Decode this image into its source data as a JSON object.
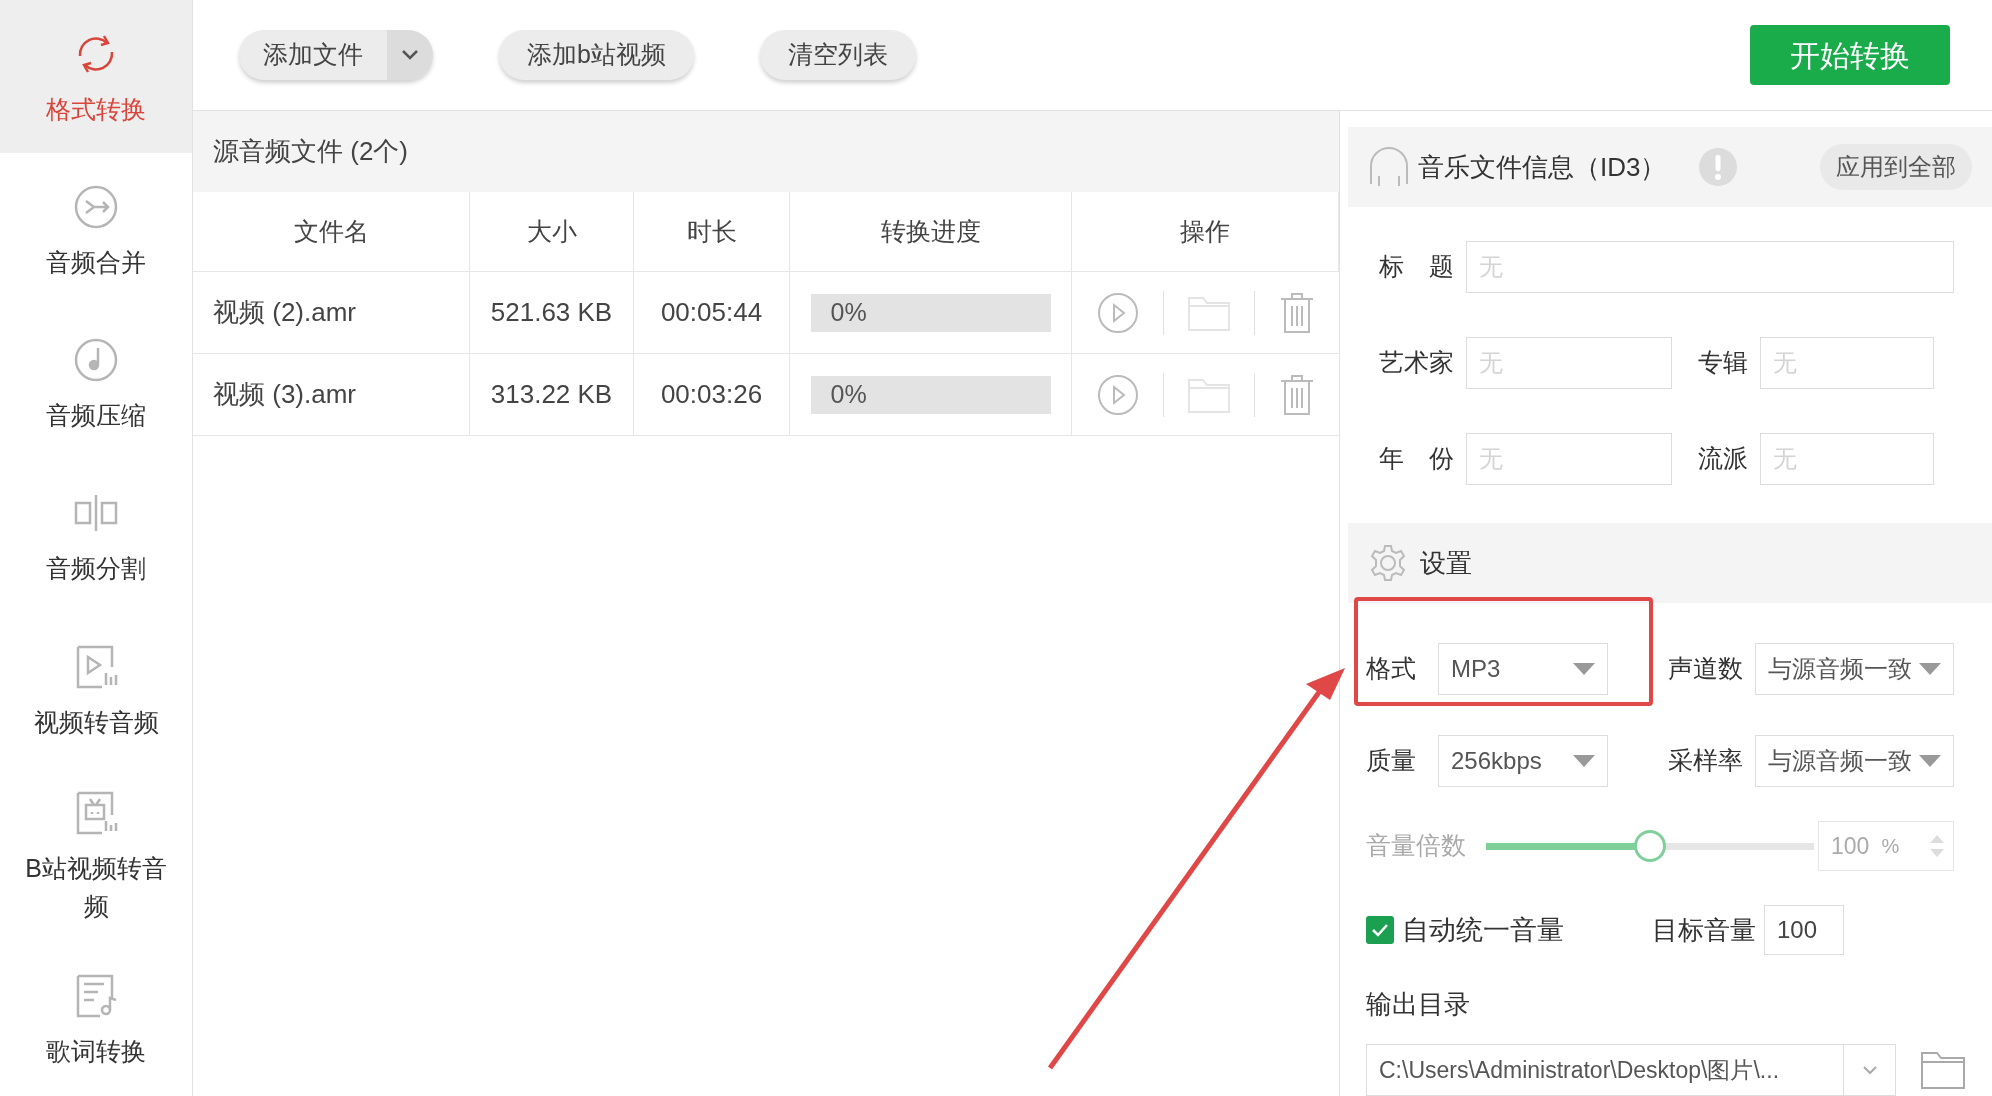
{
  "sidebar": {
    "items": [
      {
        "label": "格式转换",
        "selected": true
      },
      {
        "label": "音频合并",
        "selected": false
      },
      {
        "label": "音频压缩",
        "selected": false
      },
      {
        "label": "音频分割",
        "selected": false
      },
      {
        "label": "视频转音频",
        "selected": false
      },
      {
        "label": "B站视频转音频",
        "selected": false
      },
      {
        "label": "歌词转换",
        "selected": false
      }
    ]
  },
  "toolbar": {
    "buttons": [
      {
        "label": "添加文件",
        "kind": "dropdown"
      },
      {
        "label": "添加b站视频",
        "kind": "plain"
      },
      {
        "label": "清空列表",
        "kind": "plain"
      }
    ],
    "start_button": "开始转换"
  },
  "file_list": {
    "title": "源音频文件 (2个)",
    "columns": [
      "文件名",
      "大小",
      "时长",
      "转换进度",
      "操作"
    ],
    "rows": [
      {
        "name": "视频 (2).amr",
        "size": "521.63 KB",
        "duration": "00:05:44",
        "progress": "0%",
        "level": 0
      },
      {
        "name": "视频 (3).amr",
        "size": "313.22 KB",
        "duration": "00:03:26",
        "progress": "0%",
        "level": 0
      }
    ]
  },
  "id3": {
    "title": "音乐文件信息（ID3）",
    "apply_button": "应用到全部",
    "fields": [
      {
        "label": "标　题",
        "placeholder": "无",
        "kind": "wide"
      },
      {
        "label": "艺术家",
        "placeholder": "无",
        "kind": "half"
      },
      {
        "label": "专辑",
        "placeholder": "无",
        "kind": "half"
      },
      {
        "label": "年　份",
        "placeholder": "无",
        "kind": "half"
      },
      {
        "label": "流派",
        "placeholder": "无",
        "kind": "half"
      }
    ]
  },
  "settings": {
    "title": "设置",
    "selects": [
      {
        "label": "格式",
        "value": "MP3"
      },
      {
        "label": "声道数",
        "value": "与源音频一致"
      },
      {
        "label": "质量",
        "value": "256kbps"
      },
      {
        "label": "采样率",
        "value": "与源音频一致"
      }
    ],
    "volume": {
      "label": "音量倍数",
      "level": 0.5,
      "value": "100",
      "unit": "%",
      "disabled": true
    },
    "auto_volume": {
      "label": "自动统一音量",
      "checked": true
    },
    "target_volume": {
      "label": "目标音量",
      "value": "100"
    },
    "output": {
      "label": "输出目录",
      "path": "C:\\Users\\Administrator\\Desktop\\图片\\..."
    }
  }
}
